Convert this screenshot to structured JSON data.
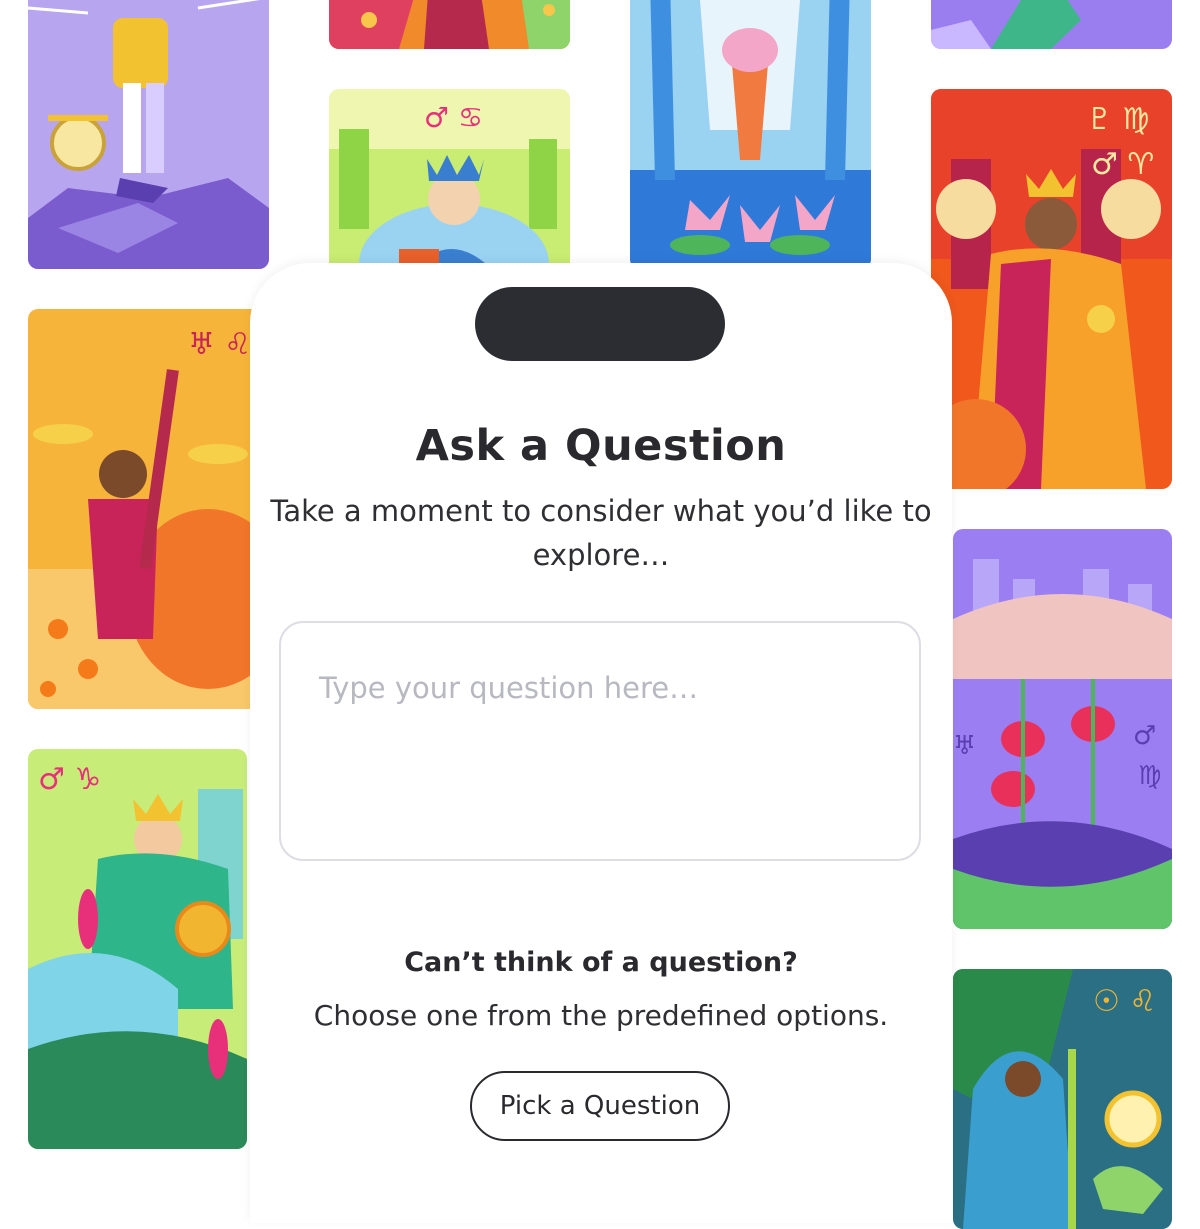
{
  "panel": {
    "title": "Ask a Question",
    "subtitle": "Take a moment to consider what you’d like to explore…",
    "input_placeholder": "Type your question here…",
    "input_value": "",
    "helper_heading": "Can’t think of a question?",
    "helper_text": "Choose one from the predefined options.",
    "pick_button_label": "Pick a Question"
  },
  "colors": {
    "text_primary": "#2a2a2e",
    "placeholder": "#b7b8c0",
    "notch": "#2b2d33",
    "input_border": "#dddde3"
  },
  "background_cards": [
    {
      "name": "tarot-card-dancer",
      "colors": [
        "#b7a6ef",
        "#f2c230",
        "#7b5ccf"
      ]
    },
    {
      "name": "tarot-card-top-red",
      "colors": [
        "#e04060",
        "#f08a2a",
        "#b52a4c"
      ]
    },
    {
      "name": "tarot-card-queen-of-cups",
      "colors": [
        "#dff0a0",
        "#6fc4e8",
        "#3a7fcf"
      ]
    },
    {
      "name": "tarot-card-ace-of-cups",
      "colors": [
        "#2f79d8",
        "#9ad3f2",
        "#f3a6c8"
      ]
    },
    {
      "name": "tarot-card-top-purple",
      "colors": [
        "#9a7ef0",
        "#3fb58a",
        "#6a56c4"
      ]
    },
    {
      "name": "tarot-card-king-of-wands",
      "colors": [
        "#f0581c",
        "#f7a12a",
        "#b6244c"
      ]
    },
    {
      "name": "tarot-card-page-of-wands",
      "colors": [
        "#f6b43a",
        "#f2762a",
        "#c8245a"
      ]
    },
    {
      "name": "tarot-card-moon-faces",
      "colors": [
        "#9b7ff2",
        "#f0c4c0",
        "#5fc46a"
      ]
    },
    {
      "name": "tarot-card-king-of-pentacles",
      "colors": [
        "#b8e86a",
        "#2fb58a",
        "#e8307a"
      ]
    },
    {
      "name": "tarot-card-hermit",
      "colors": [
        "#2a8a8c",
        "#3a9fcf",
        "#f2c230"
      ]
    }
  ],
  "astro_symbols": {
    "queen": "♂ ♋",
    "king": "♇ ♍ ♂ ♈",
    "page": "♅ ♌",
    "moon": "♅ ♂ ♍",
    "pentacles": "♂ ♑",
    "hermit": "☉ ♌"
  }
}
